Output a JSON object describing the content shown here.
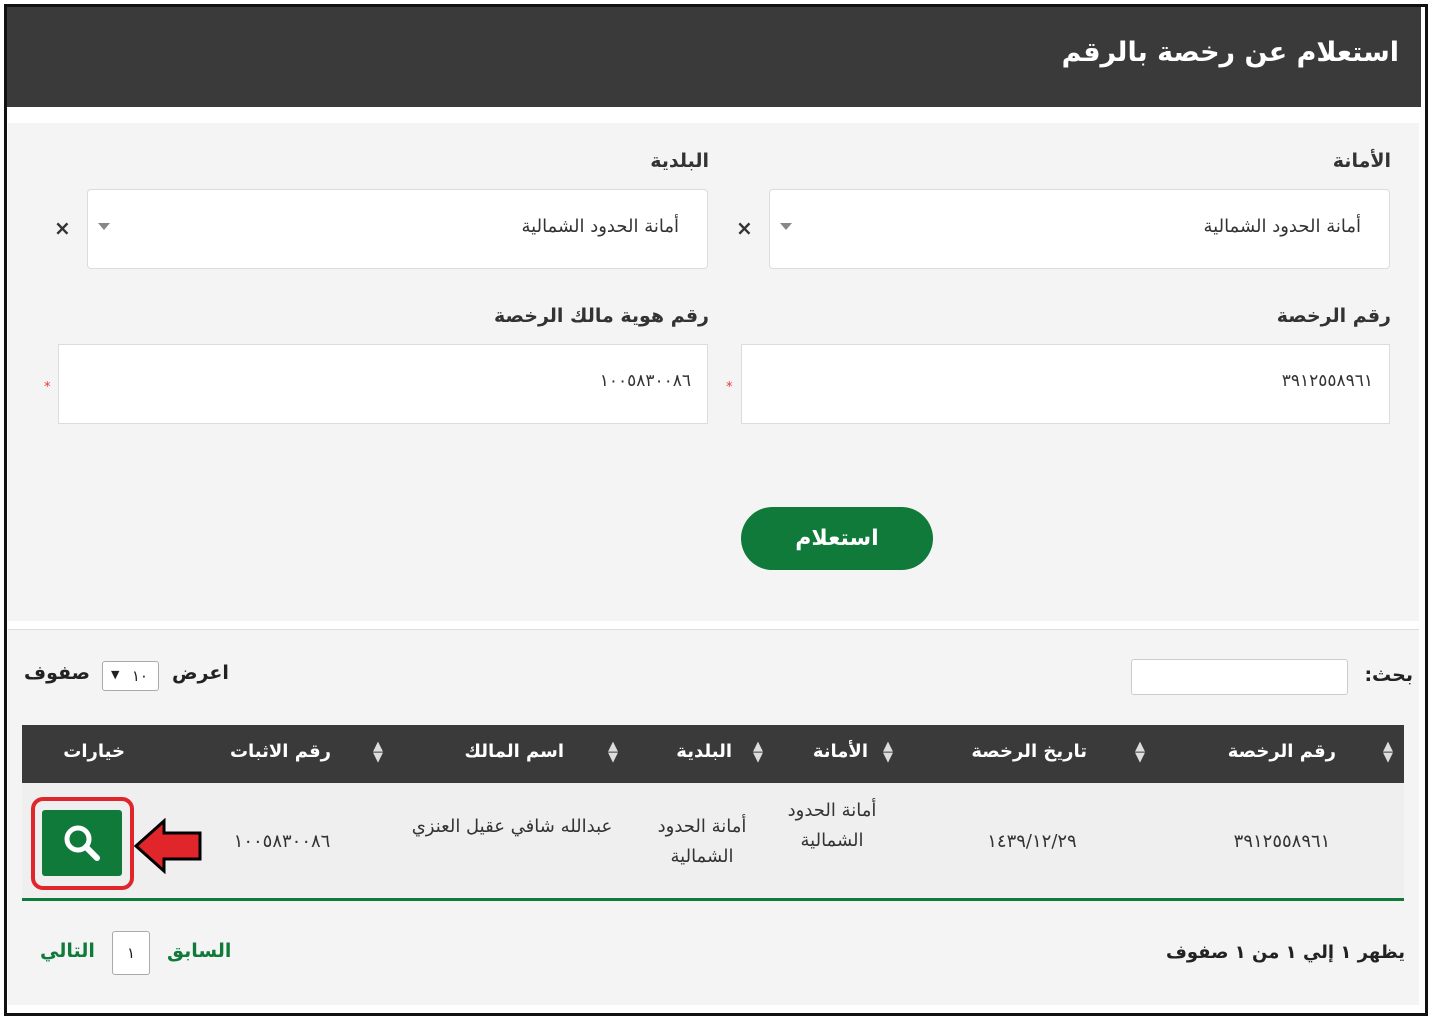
{
  "header": {
    "title": "استعلام عن رخصة بالرقم"
  },
  "form": {
    "amana": {
      "label": "الأمانة",
      "value": "أمانة الحدود الشمالية",
      "clear": "×"
    },
    "baladia": {
      "label": "البلدية",
      "value": "أمانة الحدود الشمالية",
      "clear": "×"
    },
    "license_number": {
      "label": "رقم الرخصة",
      "value": "٣٩١٢٥٥٨٩٦١",
      "required_mark": "*"
    },
    "owner_id": {
      "label": "رقم هوية مالك الرخصة",
      "value": "١٠٠٥٨٣٠٠٨٦",
      "required_mark": "*"
    },
    "submit_label": "استعلام"
  },
  "table_controls": {
    "search_label": "بحث:",
    "show_label": "اعرض",
    "page_length": "١٠",
    "rows_label": "صفوف"
  },
  "table": {
    "columns": [
      "رقم الرخصة",
      "تاريخ الرخصة",
      "الأمانة",
      "البلدية",
      "اسم المالك",
      "رقم الاثبات",
      "خيارات"
    ],
    "rows": [
      {
        "license_number": "٣٩١٢٥٥٨٩٦١",
        "license_date": "١٤٣٩/١٢/٢٩",
        "amana": "أمانة الحدود الشمالية",
        "baladia": "أمانة الحدود الشمالية",
        "owner_name": "عبدالله شافي عقيل العنزي",
        "id_number": "١٠٠٥٨٣٠٠٨٦"
      }
    ]
  },
  "pagination": {
    "info": "يظهر ١ إلي ١ من ١ صفوف",
    "prev": "السابق",
    "page": "١",
    "next": "التالي"
  },
  "colors": {
    "header_bg": "#3a3a3a",
    "accent_green": "#0f7a3a",
    "highlight_red": "#e0262b"
  }
}
